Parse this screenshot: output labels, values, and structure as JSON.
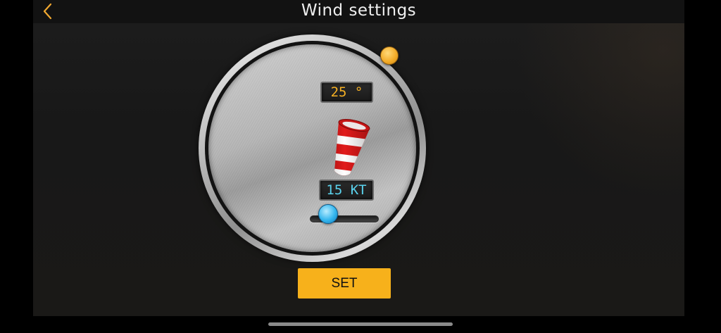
{
  "header": {
    "title": "Wind settings",
    "back_icon": "chevron-left-icon",
    "back_color": "#f0a830"
  },
  "wind": {
    "direction_display": "25 °",
    "speed_display": "15 KT",
    "direction_degrees": 25,
    "speed_knots": 15,
    "speed_slider_fraction": 0.27,
    "windsock_icon": "windsock-icon"
  },
  "actions": {
    "set_label": "SET"
  },
  "colors": {
    "accent": "#f7b11b",
    "direction_readout": "#f5b024",
    "speed_readout": "#5ad3ee",
    "slider_thumb": "#34b6ee"
  }
}
